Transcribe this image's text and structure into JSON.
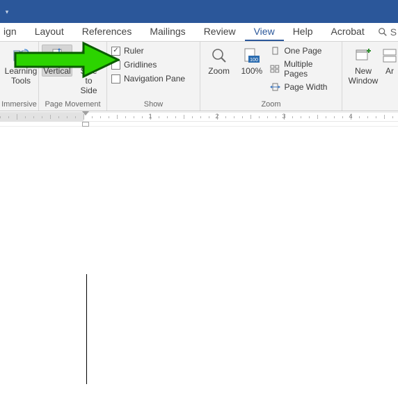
{
  "tabs": {
    "design": "ign",
    "layout": "Layout",
    "references": "References",
    "mailings": "Mailings",
    "review": "Review",
    "view": "View",
    "help": "Help",
    "acrobat": "Acrobat"
  },
  "search_stub": "S",
  "ribbon": {
    "immersive": {
      "caption": "Immersive",
      "learning_tools": "Learning\nTools"
    },
    "page_movement": {
      "caption": "Page Movement",
      "vertical": "Vertical",
      "side_to_side": "Side\nto Side"
    },
    "show": {
      "caption": "Show",
      "ruler": "Ruler",
      "gridlines": "Gridlines",
      "navpane": "Navigation Pane",
      "ruler_checked": true,
      "gridlines_checked": false,
      "navpane_checked": false
    },
    "zoom": {
      "caption": "Zoom",
      "zoom_btn": "Zoom",
      "hundred": "100%",
      "one_page": "One Page",
      "multi_pages": "Multiple Pages",
      "page_width": "Page Width"
    },
    "window": {
      "new_window": "New\nWindow",
      "arrange_stub": "Ar"
    }
  },
  "ruler_numbers": [
    "1",
    "2"
  ]
}
